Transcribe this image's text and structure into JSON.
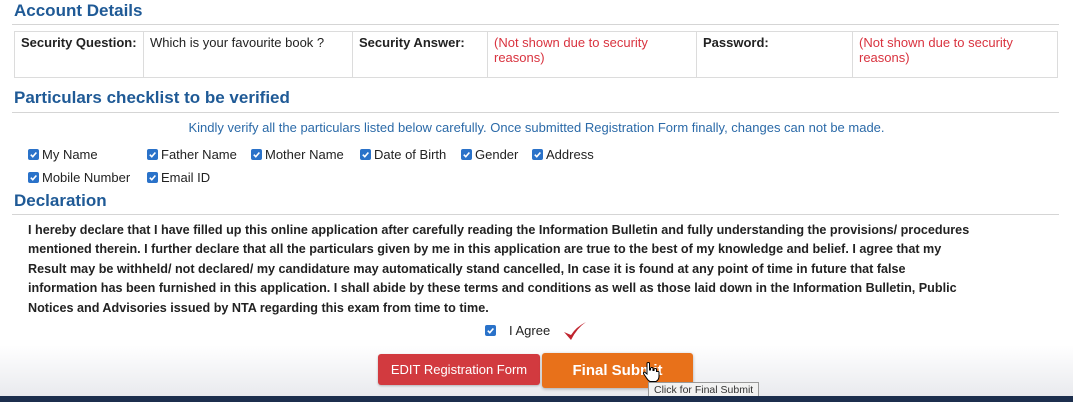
{
  "account_details": {
    "title": "Account Details",
    "security_question_label": "Security Question:",
    "security_question_value": "Which is your favourite book ?",
    "security_answer_label": "Security Answer:",
    "security_answer_value_line1": "(Not shown due to security",
    "security_answer_value_line2": "reasons)",
    "password_label": "Password:",
    "password_value_line1": "(Not shown due to security",
    "password_value_line2": "reasons)"
  },
  "checklist": {
    "title": "Particulars checklist to be verified",
    "notice": "Kindly verify all the particulars listed below carefully. Once submitted Registration Form finally, changes can not be made.",
    "items": [
      {
        "label": "My Name",
        "checked": true
      },
      {
        "label": "Father Name",
        "checked": true
      },
      {
        "label": "Mother Name",
        "checked": true
      },
      {
        "label": "Date of Birth",
        "checked": true
      },
      {
        "label": "Gender",
        "checked": true
      },
      {
        "label": "Address",
        "checked": true
      },
      {
        "label": "Mobile Number",
        "checked": true
      },
      {
        "label": "Email ID",
        "checked": true
      }
    ]
  },
  "declaration": {
    "title": "Declaration",
    "lines": [
      "I hereby declare that I have filled up this online application after carefully reading the Information Bulletin and fully understanding the provisions/ procedures",
      "mentioned therein. I further declare that all the particulars given by me in this application are true to the best of my knowledge and belief. I agree that my",
      "Result may be withheld/ not declared/ my candidature may automatically stand cancelled, In case it is found at any point of time in future that false",
      "information has been furnished in this application. I shall abide by these terms and conditions as well as those laid down in the Information Bulletin, Public",
      "Notices and Advisories issued by NTA regarding this exam from time to time."
    ],
    "agree_label": "I Agree",
    "agree_checked": true
  },
  "actions": {
    "edit_label": "EDIT Registration Form",
    "final_label": "Final Submit",
    "final_tooltip": "Click for Final Submit"
  },
  "colors": {
    "heading_blue": "#1f5a96",
    "checkbox_blue": "#2a72c9",
    "warning_red": "#d9333f",
    "edit_button": "#d23a3f",
    "final_button": "#e8711a",
    "tick_mark": "#c0242e"
  }
}
